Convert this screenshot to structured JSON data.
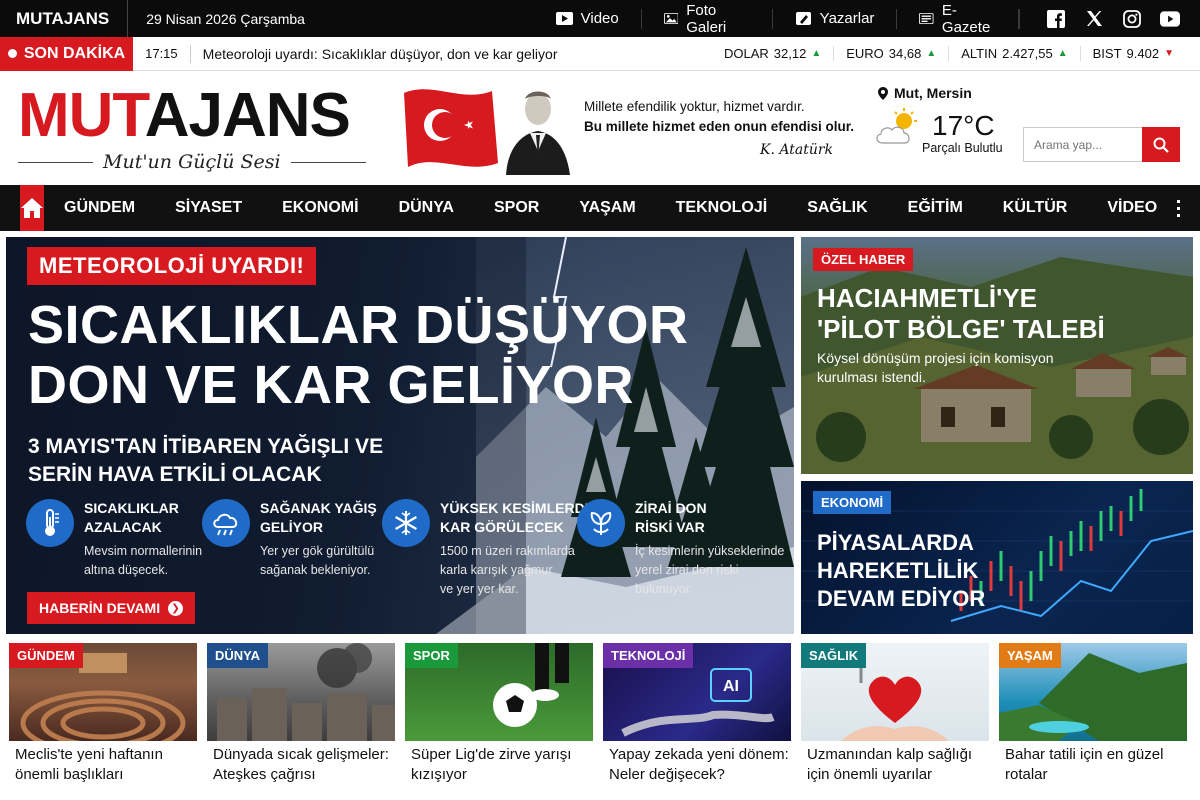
{
  "topbar": {
    "brand": "MUTAJANS",
    "date": "29 Nisan 2026 Çarşamba",
    "links": [
      {
        "label": "Video",
        "icon": "video-icon"
      },
      {
        "label": "Foto Galeri",
        "icon": "photo-gallery-icon"
      },
      {
        "label": "Yazarlar",
        "icon": "writers-icon"
      },
      {
        "label": "E-Gazete",
        "icon": "newspaper-icon"
      }
    ],
    "social": [
      "facebook-icon",
      "x-icon",
      "instagram-icon",
      "youtube-icon"
    ]
  },
  "breaking": {
    "label": "SON DAKİKA",
    "time": "17:15",
    "text": "Meteoroloji uyardı: Sıcaklıklar düşüyor, don ve kar geliyor",
    "markets": [
      {
        "name": "DOLAR",
        "value": "32,12",
        "trend": "up"
      },
      {
        "name": "EURO",
        "value": "34,68",
        "trend": "up"
      },
      {
        "name": "ALTIN",
        "value": "2.427,55",
        "trend": "up"
      },
      {
        "name": "BIST",
        "value": "9.402",
        "trend": "down"
      }
    ]
  },
  "header": {
    "logo_red": "MUT",
    "logo_black": "AJANS",
    "slogan": "Mut'un Güçlü Sesi",
    "quote_line1": "Millete efendilik yoktur, hizmet vardır.",
    "quote_line2": "Bu millete hizmet eden onun efendisi olur.",
    "signature": "K. Atatürk",
    "weather": {
      "location": "Mut, Mersin",
      "temp": "17°C",
      "desc": "Parçalı Bulutlu"
    },
    "search_placeholder": "Arama yap..."
  },
  "nav": {
    "items": [
      "GÜNDEM",
      "SİYASET",
      "EKONOMİ",
      "DÜNYA",
      "SPOR",
      "YAŞAM",
      "TEKNOLOJİ",
      "SAĞLIK",
      "EĞİTİM",
      "KÜLTÜR SANAT",
      "VİDEO"
    ]
  },
  "hero": {
    "tag": "METEOROLOJİ UYARDI!",
    "title_line1": "SICAKLIKLAR DÜŞÜYOR",
    "title_line2": "DON VE KAR GELİYOR",
    "sub_line1": "3 MAYIS'TAN İTİBAREN YAĞIŞLI VE",
    "sub_line2": "SERİN HAVA ETKİLİ OLACAK",
    "features": [
      {
        "icon": "thermometer-icon",
        "title1": "SICAKLIKLAR",
        "title2": "AZALACAK",
        "desc": [
          "Mevsim normallerinin",
          "altına düşecek."
        ]
      },
      {
        "icon": "rain-cloud-icon",
        "title1": "SAĞANAK YAĞIŞ",
        "title2": "GELİYOR",
        "desc": [
          "Yer yer gök gürültülü",
          "sağanak bekleniyor."
        ]
      },
      {
        "icon": "snowflake-icon",
        "title1": "YÜKSEK KESİMLERDE",
        "title2": "KAR GÖRÜLECEK",
        "desc": [
          "1500 m üzeri rakımlarda",
          "karla karışık yağmur",
          "ve yer yer kar."
        ]
      },
      {
        "icon": "leaf-icon",
        "title1": "ZİRAİ DON",
        "title2": "RİSKİ VAR",
        "desc": [
          "İç kesimlerin yükseklerinde",
          "yerel zirai don riski",
          "bulunuyor."
        ]
      }
    ],
    "button": "HABERİN DEVAMI"
  },
  "side1": {
    "tag": "ÖZEL HABER",
    "title_line1": "HACIAHMETLİ'YE",
    "title_line2": "'PİLOT BÖLGE' TALEBİ",
    "desc_line1": "Köysel dönüşüm projesi için komisyon",
    "desc_line2": "kurulması istendi."
  },
  "side2": {
    "tag": "EKONOMİ",
    "title_line1": "PİYASALARDA",
    "title_line2": "HAREKETLİLİK",
    "title_line3": "DEVAM EDİYOR"
  },
  "cards": [
    {
      "tag": "GÜNDEM",
      "color": "#d71920",
      "title": [
        "Meclis'te yeni haftanın",
        "önemli başlıkları"
      ]
    },
    {
      "tag": "DÜNYA",
      "color": "#1f4f8c",
      "title": [
        "Dünyada sıcak gelişmeler:",
        "Ateşkes çağrısı"
      ]
    },
    {
      "tag": "SPOR",
      "color": "#1a9a3b",
      "title": [
        "Süper Lig'de zirve yarışı",
        "kızışıyor"
      ]
    },
    {
      "tag": "TEKNOLOJİ",
      "color": "#6b2fa8",
      "title": [
        "Yapay zekada yeni dönem:",
        "Neler değişecek?"
      ]
    },
    {
      "tag": "SAĞLIK",
      "color": "#127a7a",
      "title": [
        "Uzmanından kalp sağlığı",
        "için önemli uyarılar"
      ]
    },
    {
      "tag": "YAŞAM",
      "color": "#e07b16",
      "title": [
        "Bahar tatili için en güzel",
        "rotalar"
      ]
    }
  ],
  "colors": {
    "accent": "#d71920",
    "dark": "#111111",
    "blue": "#1f6bc7"
  }
}
